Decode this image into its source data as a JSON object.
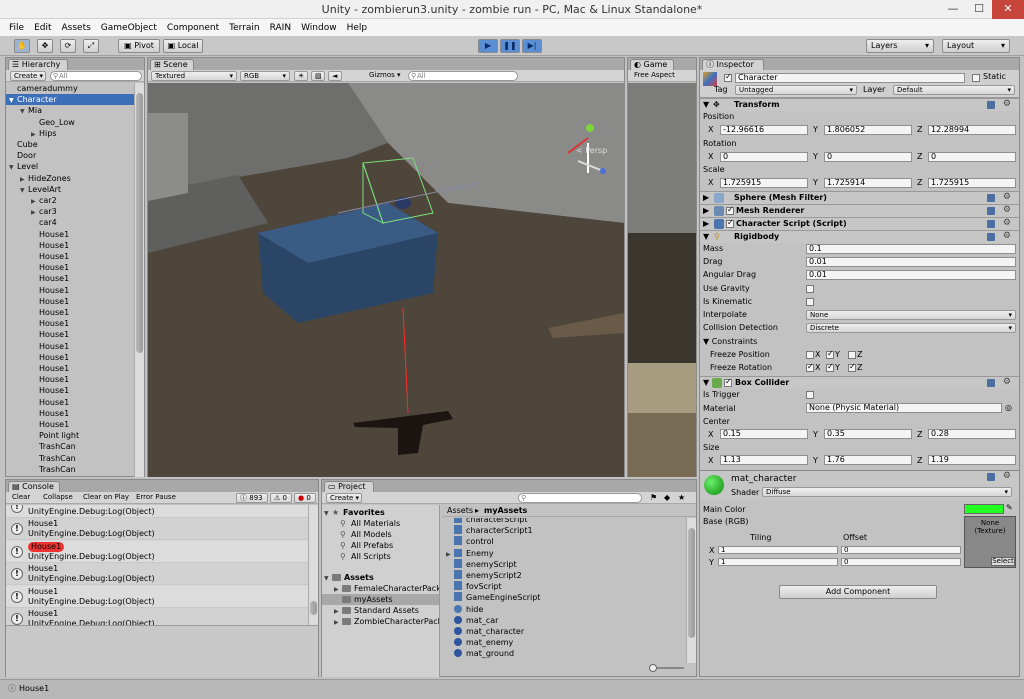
{
  "window": {
    "title": "Unity - zombierun3.unity - zombie run - PC, Mac & Linux Standalone*",
    "min": "—",
    "max": "☐",
    "close": "✕"
  },
  "menu": [
    "File",
    "Edit",
    "Assets",
    "GameObject",
    "Component",
    "Terrain",
    "RAIN",
    "Window",
    "Help"
  ],
  "toolbar": {
    "pivot": "Pivot",
    "local": "Local",
    "layers": "Layers",
    "layout": "Layout",
    "play": "▶",
    "pause": "❚❚",
    "step": "▶|",
    "hand": "✋",
    "move": "✥",
    "rotate": "⟳",
    "scale": "⤢"
  },
  "hierarchy": {
    "tab": "Hierarchy",
    "create": "Create ▾",
    "search_placeholder": "All",
    "items": [
      {
        "label": "cameradummy",
        "indent": 0,
        "arrow": ""
      },
      {
        "label": "Character",
        "indent": 0,
        "arrow": "▼",
        "selected": true
      },
      {
        "label": "Mia",
        "indent": 1,
        "arrow": "▼"
      },
      {
        "label": "Geo_Low",
        "indent": 2,
        "arrow": ""
      },
      {
        "label": "Hips",
        "indent": 2,
        "arrow": "▶"
      },
      {
        "label": "Cube",
        "indent": 0,
        "arrow": ""
      },
      {
        "label": "Door",
        "indent": 0,
        "arrow": ""
      },
      {
        "label": "Level",
        "indent": 0,
        "arrow": "▼"
      },
      {
        "label": "HideZones",
        "indent": 1,
        "arrow": "▶"
      },
      {
        "label": "LevelArt",
        "indent": 1,
        "arrow": "▼"
      },
      {
        "label": "car2",
        "indent": 2,
        "arrow": "▶"
      },
      {
        "label": "car3",
        "indent": 2,
        "arrow": "▶"
      },
      {
        "label": "car4",
        "indent": 2,
        "arrow": ""
      },
      {
        "label": "House1",
        "indent": 2,
        "arrow": ""
      },
      {
        "label": "House1",
        "indent": 2,
        "arrow": ""
      },
      {
        "label": "House1",
        "indent": 2,
        "arrow": ""
      },
      {
        "label": "House1",
        "indent": 2,
        "arrow": ""
      },
      {
        "label": "House1",
        "indent": 2,
        "arrow": ""
      },
      {
        "label": "House1",
        "indent": 2,
        "arrow": ""
      },
      {
        "label": "House1",
        "indent": 2,
        "arrow": ""
      },
      {
        "label": "House1",
        "indent": 2,
        "arrow": ""
      },
      {
        "label": "House1",
        "indent": 2,
        "arrow": ""
      },
      {
        "label": "House1",
        "indent": 2,
        "arrow": ""
      },
      {
        "label": "House1",
        "indent": 2,
        "arrow": ""
      },
      {
        "label": "House1",
        "indent": 2,
        "arrow": ""
      },
      {
        "label": "House1",
        "indent": 2,
        "arrow": ""
      },
      {
        "label": "House1",
        "indent": 2,
        "arrow": ""
      },
      {
        "label": "House1",
        "indent": 2,
        "arrow": ""
      },
      {
        "label": "House1",
        "indent": 2,
        "arrow": ""
      },
      {
        "label": "House1",
        "indent": 2,
        "arrow": ""
      },
      {
        "label": "House1",
        "indent": 2,
        "arrow": ""
      },
      {
        "label": "Point light",
        "indent": 2,
        "arrow": ""
      },
      {
        "label": "TrashCan",
        "indent": 2,
        "arrow": ""
      },
      {
        "label": "TrashCan",
        "indent": 2,
        "arrow": ""
      },
      {
        "label": "TrashCan",
        "indent": 2,
        "arrow": ""
      }
    ]
  },
  "scene": {
    "tab": "Scene",
    "shading": "Textured",
    "render": "RGB",
    "gizmos": "Gizmos ▾",
    "search_placeholder": "All",
    "persp": "< Persp"
  },
  "game": {
    "tab": "Game",
    "aspect": "Free Aspect"
  },
  "inspector": {
    "tab": "Inspector",
    "object_name": "Character",
    "static_label": "Static",
    "tag_label": "Tag",
    "tag_value": "Untagged",
    "layer_label": "Layer",
    "layer_value": "Default",
    "transform": {
      "title": "Transform",
      "position_label": "Position",
      "px": "-12.96616",
      "py": "1.806052",
      "pz": "12.28994",
      "rotation_label": "Rotation",
      "rx": "0",
      "ry": "0",
      "rz": "0",
      "scale_label": "Scale",
      "sx": "1.725915",
      "sy": "1.725914",
      "sz": "1.725915",
      "x": "X",
      "y": "Y",
      "z": "Z"
    },
    "mesh_filter": "Sphere (Mesh Filter)",
    "mesh_renderer": "Mesh Renderer",
    "character_script": "Character Script (Script)",
    "rigidbody": {
      "title": "Rigidbody",
      "mass_label": "Mass",
      "mass": "0.1",
      "drag_label": "Drag",
      "drag": "0.01",
      "angdrag_label": "Angular Drag",
      "angdrag": "0.01",
      "gravity_label": "Use Gravity",
      "kinematic_label": "Is Kinematic",
      "interp_label": "Interpolate",
      "interp": "None",
      "coll_label": "Collision Detection",
      "coll": "Discrete",
      "constraints_label": "Constraints",
      "fpos_label": "Freeze Position",
      "frot_label": "Freeze Rotation"
    },
    "box_collider": {
      "title": "Box Collider",
      "trigger_label": "Is Trigger",
      "material_label": "Material",
      "material": "None (Physic Material)",
      "center_label": "Center",
      "cx": "0.15",
      "cy": "0.35",
      "cz": "0.28",
      "size_label": "Size",
      "sx": "1.13",
      "sy": "1.76",
      "sz": "1.19"
    },
    "material": {
      "name": "mat_character",
      "shader_label": "Shader",
      "shader": "Diffuse",
      "main_color_label": "Main Color",
      "base_label": "Base (RGB)",
      "tiling_label": "Tiling",
      "offset_label": "Offset",
      "tx": "1",
      "ty": "1",
      "ox": "0",
      "oy": "0",
      "texture_none": "None\n(Texture)",
      "select": "Select",
      "main_color": "#22ff22"
    },
    "add_component": "Add Component"
  },
  "console": {
    "tab": "Console",
    "clear": "Clear",
    "collapse": "Collapse",
    "clear_on_play": "Clear on Play",
    "error_pause": "Error Pause",
    "count_info": "893",
    "count_warn": "0",
    "count_err": "0",
    "messages": [
      {
        "line1": "",
        "line2": "UnityEngine.Debug:Log(Object)"
      },
      {
        "line1": "House1",
        "line2": "UnityEngine.Debug:Log(Object)"
      },
      {
        "line1": "House1",
        "line2": "UnityEngine.Debug:Log(Object)",
        "highlight": true
      },
      {
        "line1": "House1",
        "line2": "UnityEngine.Debug:Log(Object)"
      },
      {
        "line1": "House1",
        "line2": "UnityEngine.Debug:Log(Object)"
      },
      {
        "line1": "House1",
        "line2": "UnityEngine.Debug:Log(Object)"
      }
    ]
  },
  "project": {
    "tab": "Project",
    "create": "Create ▾",
    "breadcrumb_root": "Assets",
    "breadcrumb_current": "myAssets",
    "favorites": {
      "title": "Favorites",
      "items": [
        "All Materials",
        "All Models",
        "All Prefabs",
        "All Scripts"
      ]
    },
    "assets": {
      "title": "Assets",
      "items": [
        {
          "label": "FemaleCharacterPack",
          "arrow": "▶"
        },
        {
          "label": "myAssets",
          "arrow": "",
          "selected": true
        },
        {
          "label": "Standard Assets",
          "arrow": "▶"
        },
        {
          "label": "ZombieCharacterPack",
          "arrow": "▶"
        }
      ]
    },
    "files": [
      {
        "label": "characterScript"
      },
      {
        "label": "characterScript1"
      },
      {
        "label": "control"
      },
      {
        "label": "Enemy",
        "arrow": "▶"
      },
      {
        "label": "enemyScript"
      },
      {
        "label": "enemyScript2"
      },
      {
        "label": "fovScript"
      },
      {
        "label": "GameEngineScript"
      },
      {
        "label": "hide"
      },
      {
        "label": "mat_car"
      },
      {
        "label": "mat_character"
      },
      {
        "label": "mat_enemy"
      },
      {
        "label": "mat_ground"
      }
    ]
  },
  "statusbar": {
    "text": "House1"
  },
  "colors": {
    "accent": "#3a72c4",
    "selected": "#3d6fb8",
    "highlight": "#ee3333"
  }
}
